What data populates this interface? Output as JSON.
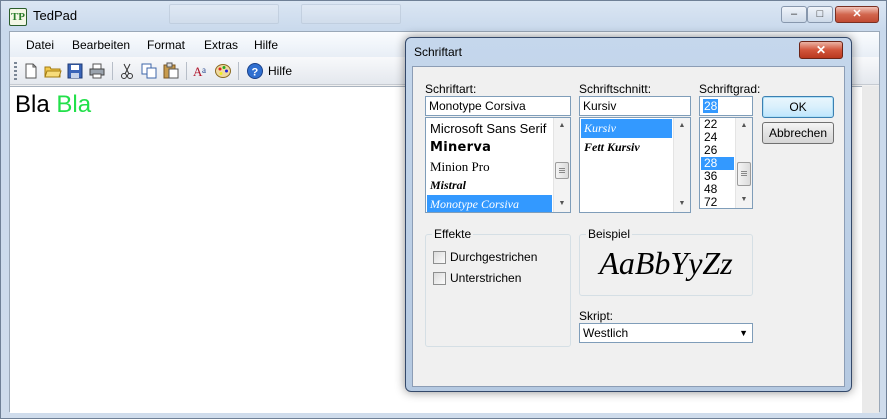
{
  "window": {
    "title": "TedPad",
    "icon_text": "TP",
    "minimize": "–",
    "maximize": "□",
    "close": "✕"
  },
  "menu": [
    "Datei",
    "Bearbeiten",
    "Format",
    "Extras",
    "Hilfe"
  ],
  "toolbar": {
    "icons": [
      "new-file-icon",
      "open-folder-icon",
      "save-icon",
      "print-icon",
      "cut-icon",
      "copy-icon",
      "paste-icon",
      "font-icon",
      "color-palette-icon",
      "help-icon"
    ],
    "help_label": "Hilfe"
  },
  "document": {
    "word1": "Bla",
    "word2": "Bla",
    "word2_color": "#22e04a"
  },
  "dialog": {
    "title": "Schriftart",
    "close": "✕",
    "font_label": "Schriftart:",
    "font_value": "Monotype Corsiva",
    "fonts": [
      "Microsoft Sans Serif",
      "Minerva",
      "Minion Pro",
      "Mistral",
      "Monotype Corsiva"
    ],
    "selected_font": "Monotype Corsiva",
    "style_label": "Schriftschnitt:",
    "style_value": "Kursiv",
    "styles": [
      "Kursiv",
      "Fett Kursiv"
    ],
    "selected_style": "Kursiv",
    "size_label": "Schriftgrad:",
    "size_value": "28",
    "sizes": [
      "22",
      "24",
      "26",
      "28",
      "36",
      "48",
      "72"
    ],
    "selected_size": "28",
    "ok": "OK",
    "cancel": "Abbrechen",
    "effects_label": "Effekte",
    "strikeout": "Durchgestrichen",
    "underline": "Unterstrichen",
    "sample_label": "Beispiel",
    "sample_text": "AaBbYyZz",
    "script_label": "Skript:",
    "script_value": "Westlich",
    "selection_color": "#3399ff"
  }
}
